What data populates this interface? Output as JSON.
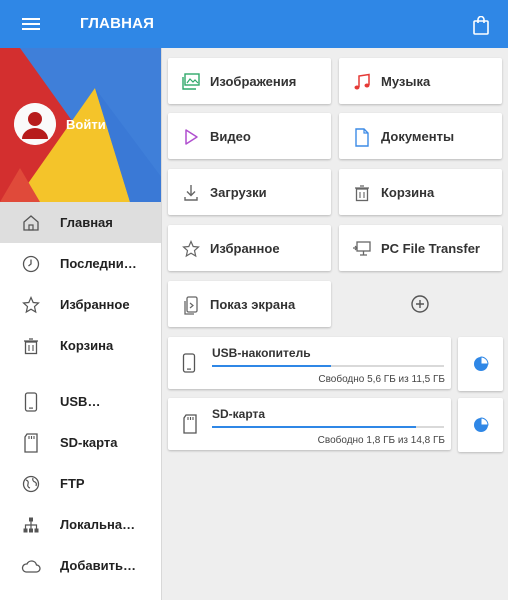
{
  "appbar": {
    "title": "ГЛАВНАЯ",
    "menu_icon": "hamburger-menu-icon",
    "action_icon": "shopping-bag-icon",
    "color": "#2f87e6"
  },
  "drawer": {
    "login_label": "Войти",
    "header_colors": {
      "red": "#d32f2f",
      "yellow": "#f4c42a",
      "blue": "#3f7fd9"
    },
    "items": [
      {
        "label": "Главная",
        "icon": "home-icon",
        "active": true
      },
      {
        "label": "Последни…",
        "icon": "clock-icon"
      },
      {
        "label": "Избранное",
        "icon": "star-icon"
      },
      {
        "label": "Корзина",
        "icon": "trash-icon"
      },
      {
        "label": "USB…",
        "icon": "phone-icon"
      },
      {
        "label": "SD-карта",
        "icon": "sd-card-icon"
      },
      {
        "label": "FTP",
        "icon": "globe-icon"
      },
      {
        "label": "Локальна…",
        "icon": "network-icon"
      },
      {
        "label": "Добавить…",
        "icon": "cloud-icon"
      }
    ]
  },
  "categories": [
    {
      "label": "Изображения",
      "icon": "images-icon",
      "color": "#2fa86a"
    },
    {
      "label": "Музыка",
      "icon": "music-icon",
      "color": "#e53935"
    },
    {
      "label": "Видео",
      "icon": "video-icon",
      "color": "#b04fcf"
    },
    {
      "label": "Документы",
      "icon": "document-icon",
      "color": "#3d8be6"
    },
    {
      "label": "Загрузки",
      "icon": "download-icon",
      "color": "#666666"
    },
    {
      "label": "Корзина",
      "icon": "trash-icon",
      "color": "#666666"
    },
    {
      "label": "Избранное",
      "icon": "star-icon",
      "color": "#666666"
    },
    {
      "label": "PC File Transfer",
      "icon": "pc-transfer-icon",
      "color": "#666666"
    },
    {
      "label": "Показ экрана",
      "icon": "screen-cast-icon",
      "color": "#666666"
    }
  ],
  "add_icon": "add-circle-icon",
  "storage": [
    {
      "name": "USB-накопитель",
      "free_text": "Свободно 5,6 ГБ из 11,5 ГБ",
      "used_fraction": 0.513,
      "icon": "phone-icon"
    },
    {
      "name": "SD-карта",
      "free_text": "Свободно 1,8 ГБ из 14,8 ГБ",
      "used_fraction": 0.878,
      "icon": "sd-card-icon"
    }
  ]
}
